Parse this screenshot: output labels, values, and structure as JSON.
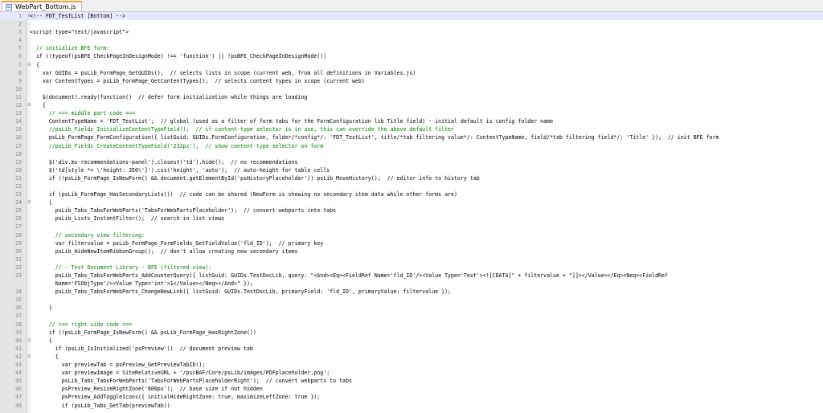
{
  "tab": {
    "title": "WebPart_Bottom.js",
    "icon": "javascript-file-icon"
  },
  "lines": [
    {
      "n": "1",
      "t": "<!-- FDT_TestList [Bottom] -->",
      "type": "html",
      "fold": "-"
    },
    {
      "n": "2",
      "t": "",
      "fold": ""
    },
    {
      "n": "3",
      "t": "<script type=\"text/javascript\">",
      "type": "html",
      "fold": ""
    },
    {
      "n": "4",
      "t": "",
      "fold": ""
    },
    {
      "n": "5",
      "t": "  // initialize BFE form:",
      "type": "cm",
      "fold": ""
    },
    {
      "n": "6",
      "t": "  if ((typeof(psBFE_CheckPageInDesignMode) !== 'function') || !psBFE_CheckPageInDesignMode())",
      "fold": ""
    },
    {
      "n": "7",
      "t": "  {",
      "fold": "-"
    },
    {
      "n": "8",
      "t": "    var GUIDs = psLib_FormPage_GetGUIDs();  // selects lists in scope (current web, from all definitions in Variables.js)",
      "fold": ""
    },
    {
      "n": "9",
      "t": "    var ContentTypes = psLib_FormPage_GetContentTypes();  // selects content types in scope (current web)",
      "fold": ""
    },
    {
      "n": "10",
      "t": "",
      "fold": ""
    },
    {
      "n": "11",
      "t": "    $(document).ready(function()  // defer form initialization while things are loading",
      "fold": ""
    },
    {
      "n": "12",
      "t": "    {",
      "fold": "-"
    },
    {
      "n": "13",
      "t": "      // === middle part code ===",
      "type": "cm",
      "fold": ""
    },
    {
      "n": "14",
      "t": "      ContentTypeName = 'FDT_TestList';  // global (used as a filter of form tabs for the FormConfiguration lib Title field) - initial default is config folder name",
      "fold": ""
    },
    {
      "n": "15",
      "t": "      //psLib_Fields_InitializeContentTypeField();  // if content-type selector is in use, this can override the above default filter",
      "type": "cm",
      "fold": ""
    },
    {
      "n": "16",
      "t": "      psLib_FormPage_FormConfiguration({ listGuid: GUIDs.FormConfiguration, folder/*config*/: 'FDT_TestList', title/*tab filtering value*/: ContentTypeName, field/*tab filtering field*/: 'Title' });  // init BFE form",
      "fold": ""
    },
    {
      "n": "17",
      "t": "      //psLib_Fields_CreateContentTypeField('232px');  // show content-type selector on form",
      "type": "cm",
      "fold": ""
    },
    {
      "n": "18",
      "t": "",
      "fold": ""
    },
    {
      "n": "19",
      "t": "      $('div.ms-recommendations-panel').closest('td').hide();  // no recommendations",
      "fold": ""
    },
    {
      "n": "20",
      "t": "      $('td[style *= \\'height: 350\\']').css('height', 'auto');  // auto-height for table cells",
      "fold": ""
    },
    {
      "n": "21",
      "t": "      if (!psLib_FormPage_IsNewForm() && document.getElementById('psHistoryPlaceholder')) psLib_MoveHistory();  // editor info to history tab",
      "fold": ""
    },
    {
      "n": "22",
      "t": "",
      "fold": ""
    },
    {
      "n": "23",
      "t": "      if (psLib_FormPage_HasSecondaryLists())  // code can be shared (NewForm is showing no secondary item data while other forms are)",
      "fold": ""
    },
    {
      "n": "24",
      "t": "      {",
      "fold": "-"
    },
    {
      "n": "25",
      "t": "        psLib_Tabs_TabsForWebParts('TabsForWebPartsPlaceholder');  // convert webparts into tabs",
      "fold": ""
    },
    {
      "n": "26",
      "t": "        psLib_Lists_InstantFilter();  // search in list views",
      "fold": ""
    },
    {
      "n": "27",
      "t": "",
      "fold": ""
    },
    {
      "n": "28",
      "t": "        // secondary view filtering:",
      "type": "cm",
      "fold": ""
    },
    {
      "n": "29",
      "t": "        var filtervalue = psLib_FormPage_FormFields_GetFieldValue('fld_ID');  // primary key",
      "fold": ""
    },
    {
      "n": "30",
      "t": "        psLib_HideNewItemRibbonGroup();  // don't allow creating new secondary items",
      "fold": ""
    },
    {
      "n": "31",
      "t": "",
      "fold": ""
    },
    {
      "n": "32",
      "t": "        // - Test Document Library - BFE (filtered view):",
      "type": "cm",
      "fold": ""
    },
    {
      "n": "33",
      "t": "        psLib_Tabs_TabsForWebParts_AddCounterQuery({ listGuid: GUIDs.TestDocLib, query: \"<And><Eq><FieldRef Name='fld_ID'/><Value Type='Text'><![CDATA[\" + filtervalue + \"]]></Value></Eq><Neq><FieldRef",
      "fold": ""
    },
    {
      "n": "",
      "t": "        Name='FSObjType'/><Value Type='int'>1</Value></Neq></And>\" });",
      "fold": "",
      "wrap": true
    },
    {
      "n": "34",
      "t": "        psLib_Tabs_TabsForWebParts_ChangeNewLink({ listGuid: GUIDs.TestDocLib, primaryField: 'fld_ID', primaryValue: filtervalue });",
      "fold": ""
    },
    {
      "n": "35",
      "t": "",
      "fold": ""
    },
    {
      "n": "36",
      "t": "      }",
      "fold": ""
    },
    {
      "n": "37",
      "t": "",
      "fold": ""
    },
    {
      "n": "38",
      "t": "      // === right side code ===",
      "type": "cm",
      "fold": ""
    },
    {
      "n": "39",
      "t": "      if (!psLib_FormPage_IsNewForm() && psLib_FormPage_HasRightZone())",
      "fold": ""
    },
    {
      "n": "40",
      "t": "      {",
      "fold": "-"
    },
    {
      "n": "41",
      "t": "        if (psLib_IsInitialized('psPreview'))  // document preview tab",
      "fold": ""
    },
    {
      "n": "42",
      "t": "        {",
      "fold": "-"
    },
    {
      "n": "43",
      "t": "          var previewTab = psPreview_GetPreviewTabID();",
      "fold": ""
    },
    {
      "n": "44",
      "t": "          var previewImage = SiteRelativeURL + '/pscBAF/Core/psLib/images/PDFplaceholder.png';",
      "fold": ""
    },
    {
      "n": "45",
      "t": "          psLib_Tabs_TabsForWebParts('TabsForWebPartsPlaceholderRight');  // convert webparts to tabs",
      "fold": ""
    },
    {
      "n": "46",
      "t": "          psPreview_ResizeRightZone('600px');  // base size if not hidden",
      "fold": ""
    },
    {
      "n": "47",
      "t": "          psPreview_AddToggleIcons({ initialHideRightZone: true, maximizeLeftZone: true });",
      "fold": ""
    },
    {
      "n": "48",
      "t": "          if (psLib_Tabs_GetTab(previewTab))",
      "fold": ""
    }
  ]
}
